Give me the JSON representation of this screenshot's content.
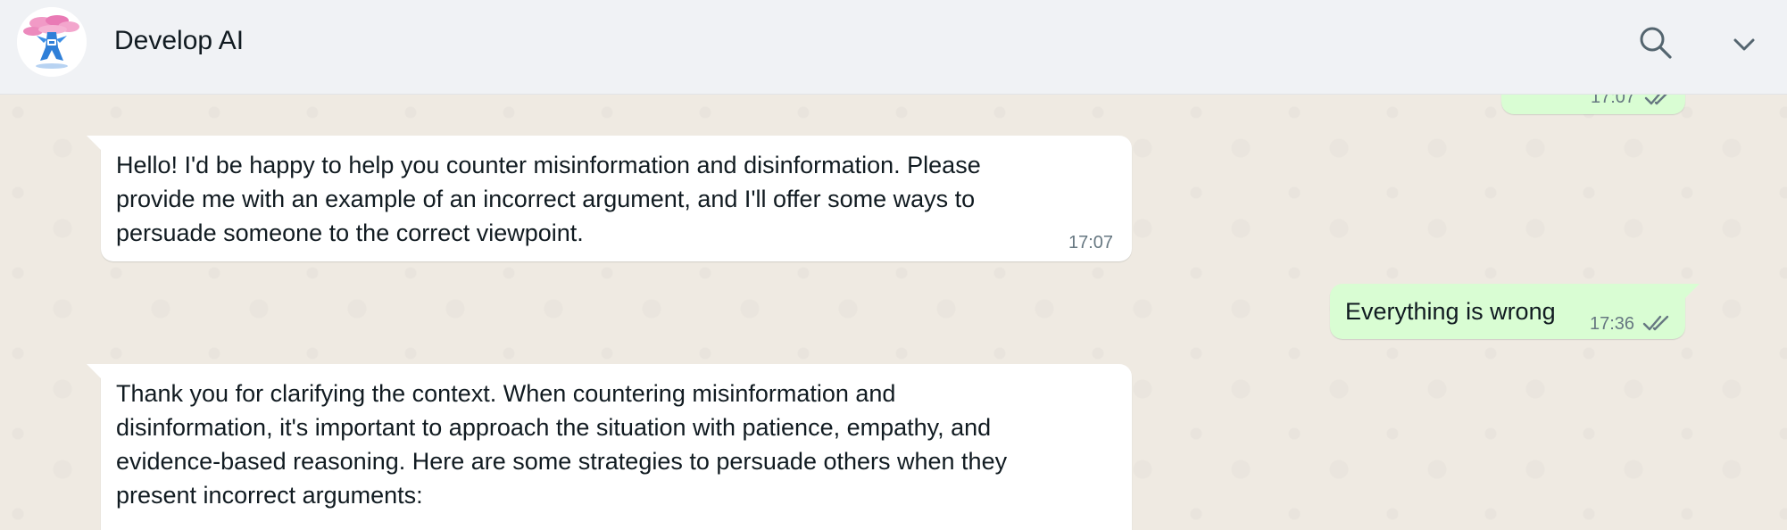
{
  "header": {
    "contact_name": "Develop AI",
    "avatar_icon": "bonsai-tree-avatar-icon",
    "search_icon": "search-icon",
    "menu_icon": "chevron-down-icon"
  },
  "colors": {
    "header_bg": "#f0f2f5",
    "chat_bg": "#efeae2",
    "incoming_bubble": "#ffffff",
    "outgoing_bubble": "#d9fdd3",
    "read_ticks": "#667781"
  },
  "messages": [
    {
      "direction": "outgoing",
      "text": "",
      "time": "17:07",
      "status": "read-double-check"
    },
    {
      "direction": "incoming",
      "text": "Hello! I'd be happy to help you counter misinformation and disinformation. Please\nprovide me with an example of an incorrect argument, and I'll offer some ways to\npersuade someone to the correct viewpoint.",
      "time": "17:07"
    },
    {
      "direction": "outgoing",
      "text": "Everything is wrong",
      "time": "17:36",
      "status": "read-double-check"
    },
    {
      "direction": "incoming",
      "text": "Thank you for clarifying the context. When countering misinformation and\ndisinformation, it's important to approach the situation with patience, empathy, and\nevidence-based reasoning. Here are some strategies to persuade others when they\npresent incorrect arguments:",
      "time": ""
    }
  ]
}
